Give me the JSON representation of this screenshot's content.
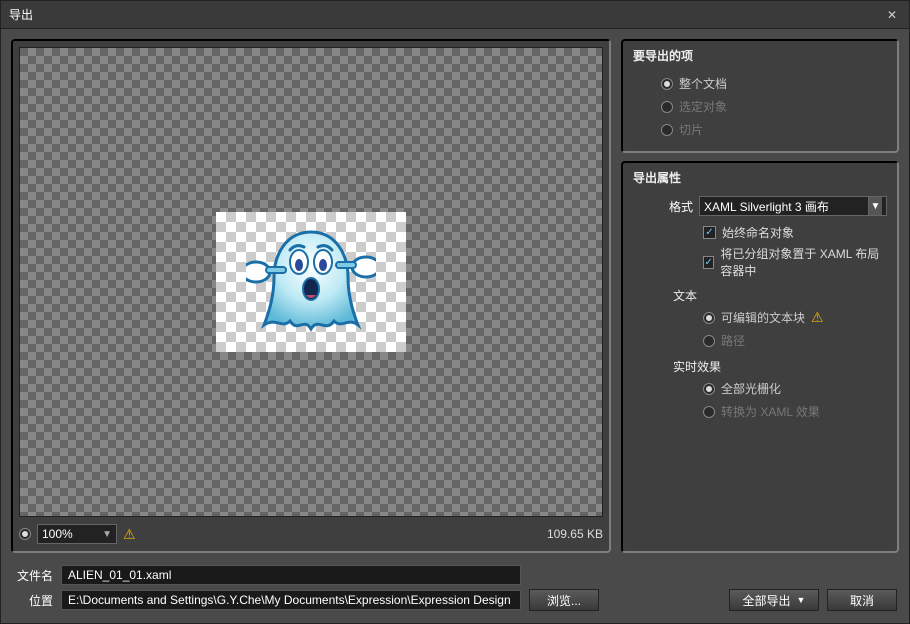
{
  "window": {
    "title": "导出"
  },
  "preview": {
    "zoom": "100%",
    "filesize": "109.65 KB"
  },
  "items_to_export": {
    "title": "要导出的项",
    "opt_whole_doc": "整个文档",
    "opt_selection": "选定对象",
    "opt_slices": "切片"
  },
  "export_props": {
    "title": "导出属性",
    "format_label": "格式",
    "format_value": "XAML Silverlight 3 画布",
    "chk_always_name": "始终命名对象",
    "chk_group_in_layout": "将已分组对象置于 XAML 布局容器中",
    "text_section": "文本",
    "opt_editable_text": "可编辑的文本块",
    "opt_paths": "路径",
    "effects_section": "实时效果",
    "opt_rasterize_all": "全部光栅化",
    "opt_convert_xaml_fx": "转换为 XAML 效果"
  },
  "footer": {
    "filename_label": "文件名",
    "filename_value": "ALIEN_01_01.xaml",
    "location_label": "位置",
    "location_value": "E:\\Documents and Settings\\G.Y.Che\\My Documents\\Expression\\Expression Design",
    "browse": "浏览...",
    "export_all": "全部导出",
    "cancel": "取消"
  }
}
